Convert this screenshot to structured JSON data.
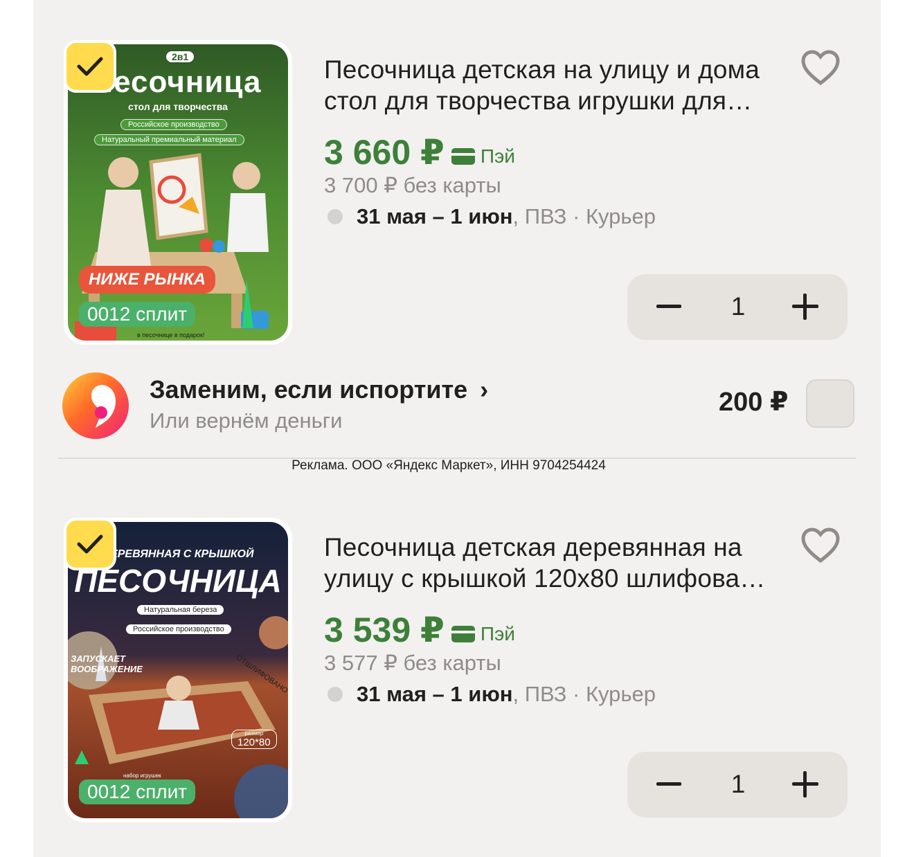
{
  "products": [
    {
      "title": "Песочница детская на улицу и дома стол для творчества игрушки для…",
      "price": "3 660 ₽",
      "pay_label": "Пэй",
      "old_price": "3 700 ₽ без карты",
      "delivery_date": "31 мая – 1 июн",
      "delivery_rest": ", ПВЗ · Курьер",
      "quantity": "1",
      "image": {
        "badge": "2в1",
        "headline": "ПЕСОЧНИЦА",
        "subheadline": "стол для творчества",
        "pill1": "Российское производство",
        "pill2": "Натуральный премиальный материал",
        "promo": "НИЖЕ РЫНКА",
        "split": "0012 сплит",
        "gift": "в песочнице в подарок!"
      }
    },
    {
      "title": "Песочница детская деревянная на улицу с крышкой 120х80 шлифова…",
      "price": "3 539 ₽",
      "pay_label": "Пэй",
      "old_price": "3 577 ₽ без карты",
      "delivery_date": "31 мая – 1 июн",
      "delivery_rest": ", ПВЗ · Курьер",
      "quantity": "1",
      "image": {
        "top": "ДЕРЕВЯННАЯ С КРЫШКОЙ",
        "headline": "ПЕСОЧНИЦА",
        "pill1": "Натуральная береза",
        "pill2": "Российское производство",
        "side": "ЗАПУСКАЕТ ВООБРАЖЕНИЕ",
        "polished": "ОТШЛИФОВАНО",
        "size_label": "размер",
        "size": "120*80",
        "toys": "набор игрушек",
        "split": "0012 сплит"
      }
    }
  ],
  "insurance": {
    "title": "Заменим, если испортите",
    "chevron": "›",
    "subtitle": "Или вернём деньги",
    "price": "200 ₽"
  },
  "ad_disclaimer": "Реклама. ООО «Яндекс Маркет», ИНН 9704254424",
  "colors": {
    "price_green": "#3e7f3a",
    "check_yellow": "#ffdb4d",
    "panel_bg": "#f2f1ef"
  }
}
